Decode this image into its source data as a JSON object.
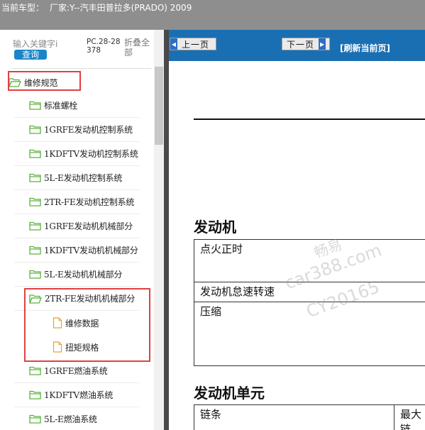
{
  "titlebar": {
    "label": "当前车型：",
    "value": "厂家:Y--汽丰田普拉多(PRADO) 2009"
  },
  "search": {
    "placeholder": "输入关键字i",
    "button_label": "查询",
    "pc_code": "PC.28-28378",
    "collapse_all": "折叠全部"
  },
  "tree": {
    "root": {
      "label": "维修规范"
    },
    "items": [
      {
        "label": "标准螺栓"
      },
      {
        "label": "1GRFE发动机控制系统"
      },
      {
        "label": "1KDFTV发动机控制系统"
      },
      {
        "label": "5L-E发动机控制系统"
      },
      {
        "label": "2TR-FE发动机控制系统"
      },
      {
        "label": "1GRFE发动机机械部分"
      },
      {
        "label": "1KDFTV发动机机械部分"
      },
      {
        "label": "5L-E发动机机械部分"
      },
      {
        "label": "2TR-FE发动机机械部分"
      }
    ],
    "leaves": [
      {
        "label": "维修数据"
      },
      {
        "label": "扭矩规格"
      }
    ],
    "after": [
      {
        "label": "1GRFE燃油系统"
      },
      {
        "label": "1KDFTV燃油系统"
      },
      {
        "label": "5L-E燃油系统"
      }
    ]
  },
  "nav": {
    "prev_label": "上一页",
    "next_label": "下一页",
    "refresh_label": "[刷新当前页]"
  },
  "document": {
    "section1_title": "发动机",
    "section1_rows": [
      "点火正时",
      "发动机怠速转速",
      "压缩"
    ],
    "section2_title": "发动机单元",
    "section2_row": {
      "c1": "链条",
      "c2": "最大链"
    }
  },
  "watermark": {
    "line1": "畅易",
    "line2": "car388.com",
    "line3": "CY20165"
  },
  "colors": {
    "titlebar_bg": "#8e8e8e",
    "nav_bar_bg": "#1a6fb3",
    "query_button_bg": "#1a86c8",
    "highlight_border": "#e04040",
    "folder_icon": "#5ab23c",
    "doc_icon": "#e8a23a"
  }
}
